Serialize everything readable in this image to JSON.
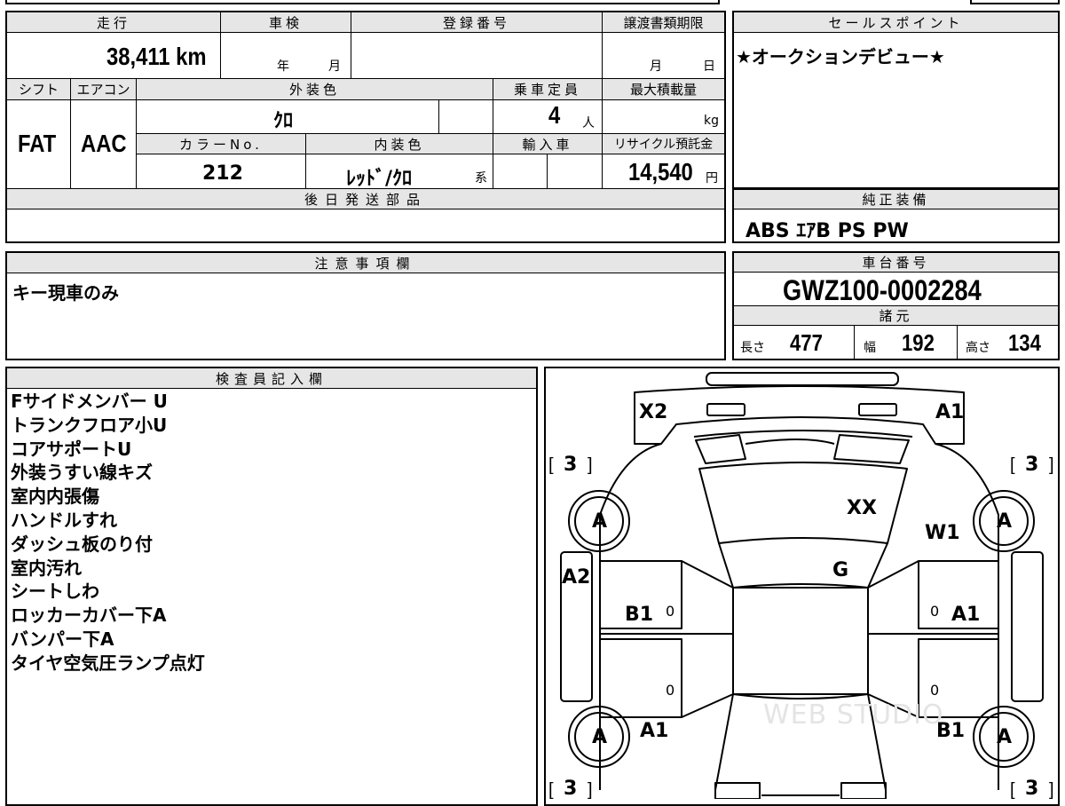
{
  "odometer": {
    "label": "走行",
    "value": "38,411 km"
  },
  "inspection": {
    "label": "車検",
    "year_unit": "年",
    "month_unit": "月"
  },
  "registration": {
    "label": "登録番号"
  },
  "transfer_deadline": {
    "label": "譲渡書類期限",
    "month_unit": "月",
    "day_unit": "日"
  },
  "sales_point": {
    "label": "セールスポイント",
    "text": "★オークションデビュー★"
  },
  "shift": {
    "label": "シフト",
    "value": "FAT"
  },
  "aircon": {
    "label": "エアコン",
    "value": "AAC"
  },
  "exterior_color": {
    "label": "外装色",
    "value": "ｸﾛ"
  },
  "capacity": {
    "label": "乗車定員",
    "value": "4",
    "unit": "人"
  },
  "max_load": {
    "label": "最大積載量",
    "unit": "kg"
  },
  "color_no": {
    "label": "カラーNo.",
    "value": "212"
  },
  "interior_color": {
    "label": "内装色",
    "value": "ﾚｯﾄﾞ/ｸﾛ",
    "suffix": "系"
  },
  "import": {
    "label": "輸入車"
  },
  "recycle": {
    "label": "リサイクル預託金",
    "value": "14,540",
    "unit": "円"
  },
  "later_parts": {
    "label": "後日発送部品"
  },
  "equipment": {
    "label": "純正装備",
    "value": "ABS ｴｱB PS PW"
  },
  "caution": {
    "label": "注意事項欄",
    "text": "キー現車のみ"
  },
  "chassis": {
    "label": "車台番号",
    "value": "GWZ100-0002284"
  },
  "specs": {
    "label": "諸元",
    "length": {
      "label": "長さ",
      "value": "477"
    },
    "width": {
      "label": "幅",
      "value": "192"
    },
    "height": {
      "label": "高さ",
      "value": "134"
    }
  },
  "inspector": {
    "label": "検査員記入欄",
    "notes": [
      "Fサイドメンバー U",
      "トランクフロア小U",
      "コアサポートU",
      "外装うすい線キズ",
      "室内内張傷",
      "ハンドルすれ",
      "ダッシュ板のり付",
      "室内汚れ",
      "シートしわ",
      "ロッカーカバー下A",
      "バンパー下A",
      "タイヤ空気圧ランプ点灯"
    ]
  },
  "diagram": {
    "tire_tl": "3",
    "tire_tr": "3",
    "tire_bl": "3",
    "tire_br": "3",
    "marks": {
      "x2": "X2",
      "a1_top": "A1",
      "xx": "XX",
      "w1": "W1",
      "g": "G",
      "a2": "A2",
      "b1_left": "B1",
      "a1_right": "A1",
      "a1_bl": "A1",
      "b1_br": "B1"
    },
    "zeros": [
      "0",
      "0",
      "0",
      "0"
    ],
    "wheel_labels": [
      "A",
      "A",
      "A",
      "A"
    ],
    "watermark": "WEB STUDIO"
  }
}
